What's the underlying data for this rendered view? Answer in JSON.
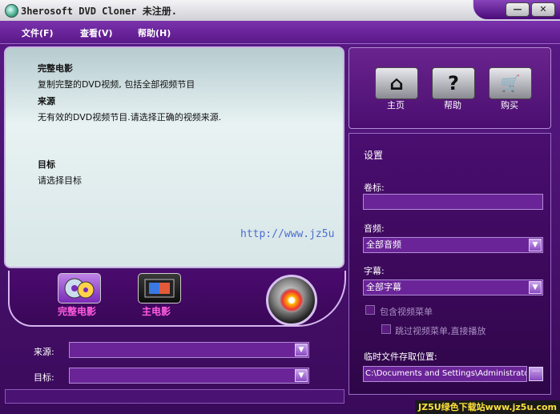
{
  "window": {
    "title": "3herosoft DVD Cloner 未注册.",
    "minimize_glyph": "—",
    "close_glyph": "✕"
  },
  "menu": [
    {
      "label": "文件(F)"
    },
    {
      "label": "查看(V)"
    },
    {
      "label": "帮助(H)"
    }
  ],
  "info": {
    "mode_title": "完整电影",
    "mode_desc": "复制完整的DVD视频, 包括全部视频节目",
    "source_title": "来源",
    "source_desc": "无有效的DVD视频节目.请选择正确的视频来源.",
    "target_title": "目标",
    "target_desc": "请选择目标"
  },
  "watermark": "http://www.jz5u",
  "modes": [
    {
      "label": "完整电影",
      "icon": "disc-copy-icon",
      "selected": true
    },
    {
      "label": "主电影",
      "icon": "film-icon",
      "selected": false
    }
  ],
  "source": {
    "label": "来源:",
    "value": ""
  },
  "target": {
    "label": "目标:",
    "value": ""
  },
  "top_buttons": [
    {
      "label": "主页",
      "icon": "home-icon",
      "glyph": "⌂"
    },
    {
      "label": "帮助",
      "icon": "help-icon",
      "glyph": "?"
    },
    {
      "label": "购买",
      "icon": "cart-icon",
      "glyph": "🛒"
    }
  ],
  "settings": {
    "title": "设置",
    "volume_label": "卷标:",
    "volume_value": "",
    "audio_label": "音频:",
    "audio_value": "全部音频",
    "subtitle_label": "字幕:",
    "subtitle_value": "全部字幕",
    "include_menu": "包含视频菜单",
    "skip_menu": "跳过视频菜单,直接播放",
    "temp_label": "临时文件存取位置:",
    "temp_path": "C:\\Documents and Settings\\Administrator\\",
    "browse_glyph": "···"
  },
  "badge": "JZ5U绿色下载站www.jz5u.com",
  "colors": {
    "accent_pink": "#ff5ce0",
    "purple_bg": "#4a0e70"
  }
}
